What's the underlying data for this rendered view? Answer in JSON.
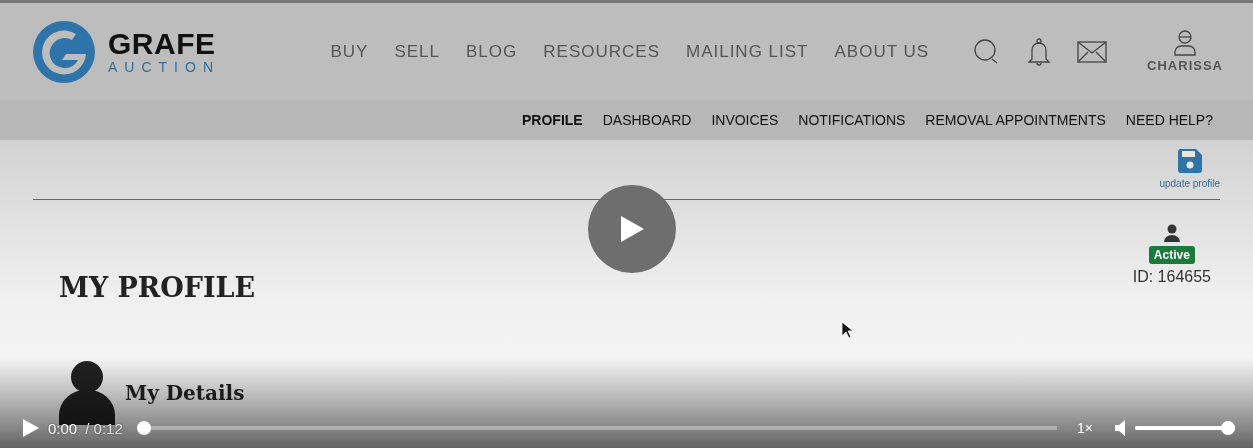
{
  "logo": {
    "name": "GRAFE",
    "tagline": "AUCTION"
  },
  "main_nav": [
    {
      "label": "BUY"
    },
    {
      "label": "SELL"
    },
    {
      "label": "BLOG"
    },
    {
      "label": "RESOURCES"
    },
    {
      "label": "MAILING LIST"
    },
    {
      "label": "ABOUT US"
    }
  ],
  "user": {
    "name": "CHARISSA"
  },
  "sub_nav": [
    {
      "label": "PROFILE",
      "selected": true
    },
    {
      "label": "DASHBOARD",
      "selected": false
    },
    {
      "label": "INVOICES",
      "selected": false
    },
    {
      "label": "NOTIFICATIONS",
      "selected": false
    },
    {
      "label": "REMOVAL APPOINTMENTS",
      "selected": false
    },
    {
      "label": "NEED HELP?",
      "selected": false
    }
  ],
  "update_button": {
    "label": "update profile"
  },
  "page_title": "MY PROFILE",
  "account": {
    "status": "Active",
    "id": "ID: 164655"
  },
  "section_title": "My Details",
  "player": {
    "current_time": "0:00",
    "duration": "/ 0:12",
    "progress": {
      "level": 0
    },
    "speed": "1×",
    "volume": {
      "level": 1
    }
  }
}
